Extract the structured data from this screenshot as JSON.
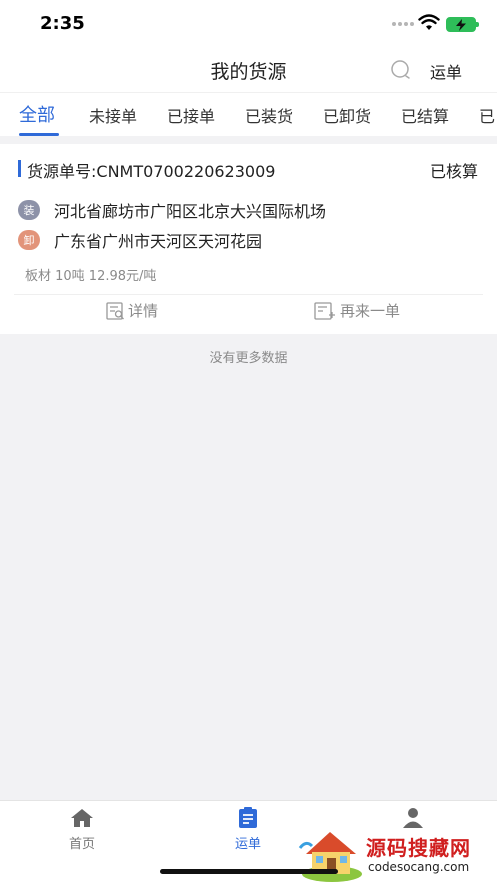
{
  "status_bar": {
    "time": "2:35"
  },
  "nav": {
    "title": "我的货源",
    "right_label": "运单",
    "search_icon": "search-icon"
  },
  "tabs": [
    {
      "label": "全部",
      "active": true
    },
    {
      "label": "未接单"
    },
    {
      "label": "已接单"
    },
    {
      "label": "已装货"
    },
    {
      "label": "已卸货"
    },
    {
      "label": "已结算"
    },
    {
      "label": "已"
    }
  ],
  "order": {
    "number": "货源单号:CNMT0700220623009",
    "status": "已核算",
    "load_badge": "装",
    "load_address": "河北省廊坊市广阳区北京大兴国际机场",
    "unload_badge": "卸",
    "unload_address": "广东省广州市天河区天河花园",
    "cargo": "板材 10吨 12.98元/吨",
    "actions": {
      "detail": "详情",
      "reorder": "再来一单"
    }
  },
  "list_footer": "没有更多数据",
  "tabbar": [
    {
      "label": "首页",
      "icon": "home-icon"
    },
    {
      "label": "运单",
      "icon": "waybill-icon",
      "active": true
    },
    {
      "label": "",
      "icon": "user-icon"
    }
  ],
  "watermark": {
    "title": "源码搜藏网",
    "url": "codesocang.com"
  },
  "colors": {
    "accent": "#2f6ad8",
    "load_badge": "#8d92a8",
    "unload_badge": "#e2947a",
    "battery": "#2ebd59"
  }
}
